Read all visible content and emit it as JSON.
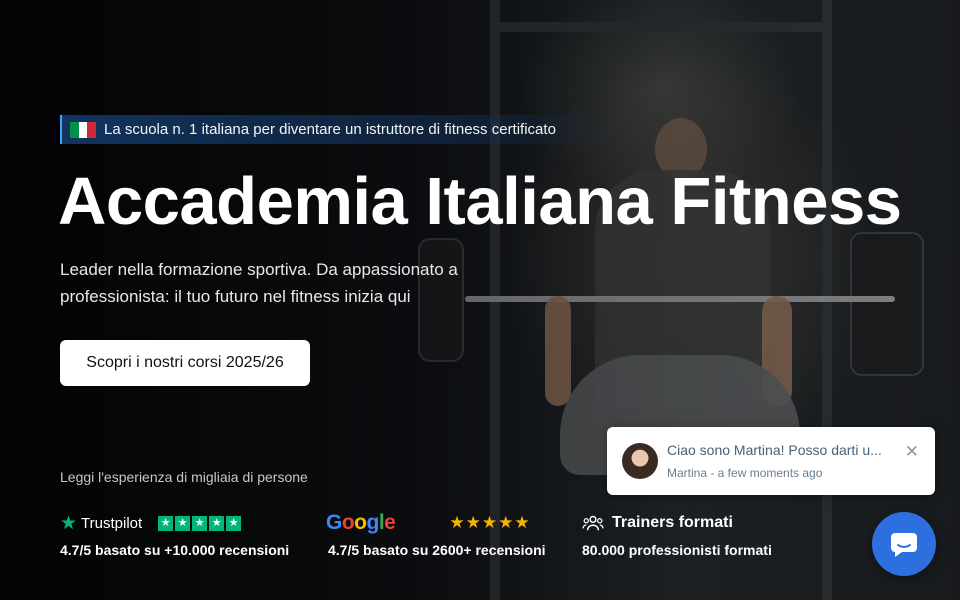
{
  "hero": {
    "badge_text": "La scuola n. 1 italiana per diventare un istruttore di fitness certificato",
    "flag_colors": [
      "#009246",
      "#ffffff",
      "#ce2b37"
    ],
    "title": "Accademia Italiana Fitness",
    "subtitle": "Leader nella formazione sportiva. Da appassionato a professionista: il tuo futuro nel fitness inizia qui",
    "cta_label": "Scopri i nostri corsi 2025/26"
  },
  "reviews": {
    "intro": "Leggi l'esperienza di migliaia di persone",
    "items": [
      {
        "brand": "Trustpilot",
        "stars": "★★★★★",
        "caption": "4.7/5 basato su +10.000 recensioni",
        "icon": "trustpilot-star-icon"
      },
      {
        "brand": "Google",
        "stars": "★★★★★",
        "caption": "4.7/5 basato su 2600+ recensioni",
        "brand_colors": [
          "#4285f4",
          "#ea4335",
          "#fbbc05",
          "#4285f4",
          "#34a853",
          "#ea4335"
        ]
      },
      {
        "brand": "Trainers formati",
        "caption": "80.000 professionisti formati",
        "icon": "people-icon"
      }
    ]
  },
  "chat": {
    "message": "Ciao sono Martina! Posso darti u...",
    "meta": "Martina - a few moments ago",
    "close_glyph": "✕",
    "fab_icon": "chat-bubble-icon",
    "accent": "#2e6fe0"
  }
}
